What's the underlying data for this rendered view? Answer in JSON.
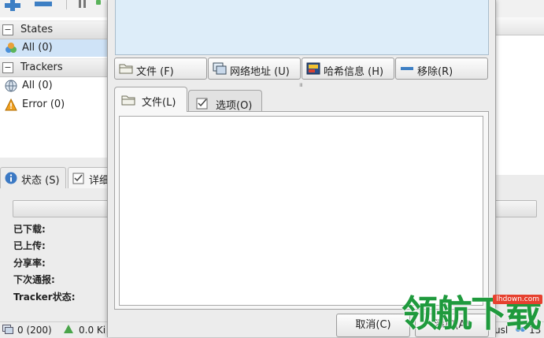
{
  "sidebar": {
    "states_header": "States",
    "states_all": "All (0)",
    "trackers_header": "Trackers",
    "trackers_all": "All (0)",
    "trackers_error": "Error (0)"
  },
  "bottom_tabs": {
    "status_tab": "状态 (S)",
    "details_tab": "详细"
  },
  "details": {
    "downloaded_label": "已下载:",
    "uploaded_label": "已上传:",
    "ratio_label": "分享率:",
    "next_announce_label": "下次通报:",
    "tracker_status_label": "Tracker状态:"
  },
  "statusbar": {
    "connections": "0 (200)",
    "download_speed": "0.0 Ki",
    "right_text": "usl",
    "right_count": "13"
  },
  "dialog": {
    "buttons": {
      "file": "文件 (F)",
      "url": "网络地址 (U)",
      "hash": "哈希信息 (H)",
      "remove": "移除(R)"
    },
    "tabs": {
      "files": "文件(L)",
      "options": "选项(O)"
    },
    "actions": {
      "cancel": "取消(C)",
      "add": "添加(A)"
    }
  },
  "watermark": {
    "text": "领航下载",
    "site": "lhdown.com"
  },
  "colors": {
    "accent_selected": "#cfe3f7",
    "torrent_list_bg": "#ddedf9",
    "watermark_green": "#1f9a3d",
    "watermark_red": "#e6412f"
  }
}
